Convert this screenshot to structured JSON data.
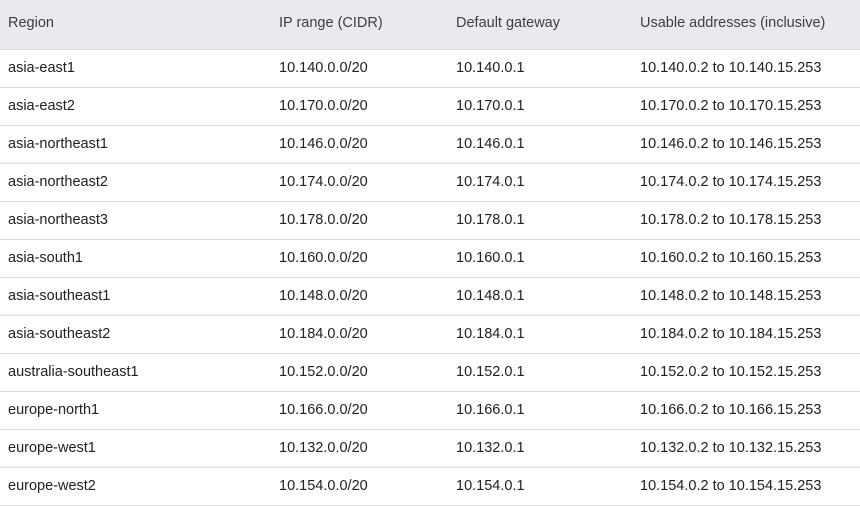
{
  "table": {
    "headers": [
      "Region",
      "IP range (CIDR)",
      "Default gateway",
      "Usable addresses (inclusive)"
    ],
    "rows": [
      [
        "asia-east1",
        "10.140.0.0/20",
        "10.140.0.1",
        "10.140.0.2 to 10.140.15.253"
      ],
      [
        "asia-east2",
        "10.170.0.0/20",
        "10.170.0.1",
        "10.170.0.2 to 10.170.15.253"
      ],
      [
        "asia-northeast1",
        "10.146.0.0/20",
        "10.146.0.1",
        "10.146.0.2 to 10.146.15.253"
      ],
      [
        "asia-northeast2",
        "10.174.0.0/20",
        "10.174.0.1",
        "10.174.0.2 to 10.174.15.253"
      ],
      [
        "asia-northeast3",
        "10.178.0.0/20",
        "10.178.0.1",
        "10.178.0.2 to 10.178.15.253"
      ],
      [
        "asia-south1",
        "10.160.0.0/20",
        "10.160.0.1",
        "10.160.0.2 to 10.160.15.253"
      ],
      [
        "asia-southeast1",
        "10.148.0.0/20",
        "10.148.0.1",
        "10.148.0.2 to 10.148.15.253"
      ],
      [
        "asia-southeast2",
        "10.184.0.0/20",
        "10.184.0.1",
        "10.184.0.2 to 10.184.15.253"
      ],
      [
        "australia-southeast1",
        "10.152.0.0/20",
        "10.152.0.1",
        "10.152.0.2 to 10.152.15.253"
      ],
      [
        "europe-north1",
        "10.166.0.0/20",
        "10.166.0.1",
        "10.166.0.2 to 10.166.15.253"
      ],
      [
        "europe-west1",
        "10.132.0.0/20",
        "10.132.0.1",
        "10.132.0.2 to 10.132.15.253"
      ],
      [
        "europe-west2",
        "10.154.0.0/20",
        "10.154.0.1",
        "10.154.0.2 to 10.154.15.253"
      ]
    ]
  },
  "colors": {
    "header_background": "#e8eaed",
    "row_divider": "#dadce0",
    "text": "#202124"
  }
}
